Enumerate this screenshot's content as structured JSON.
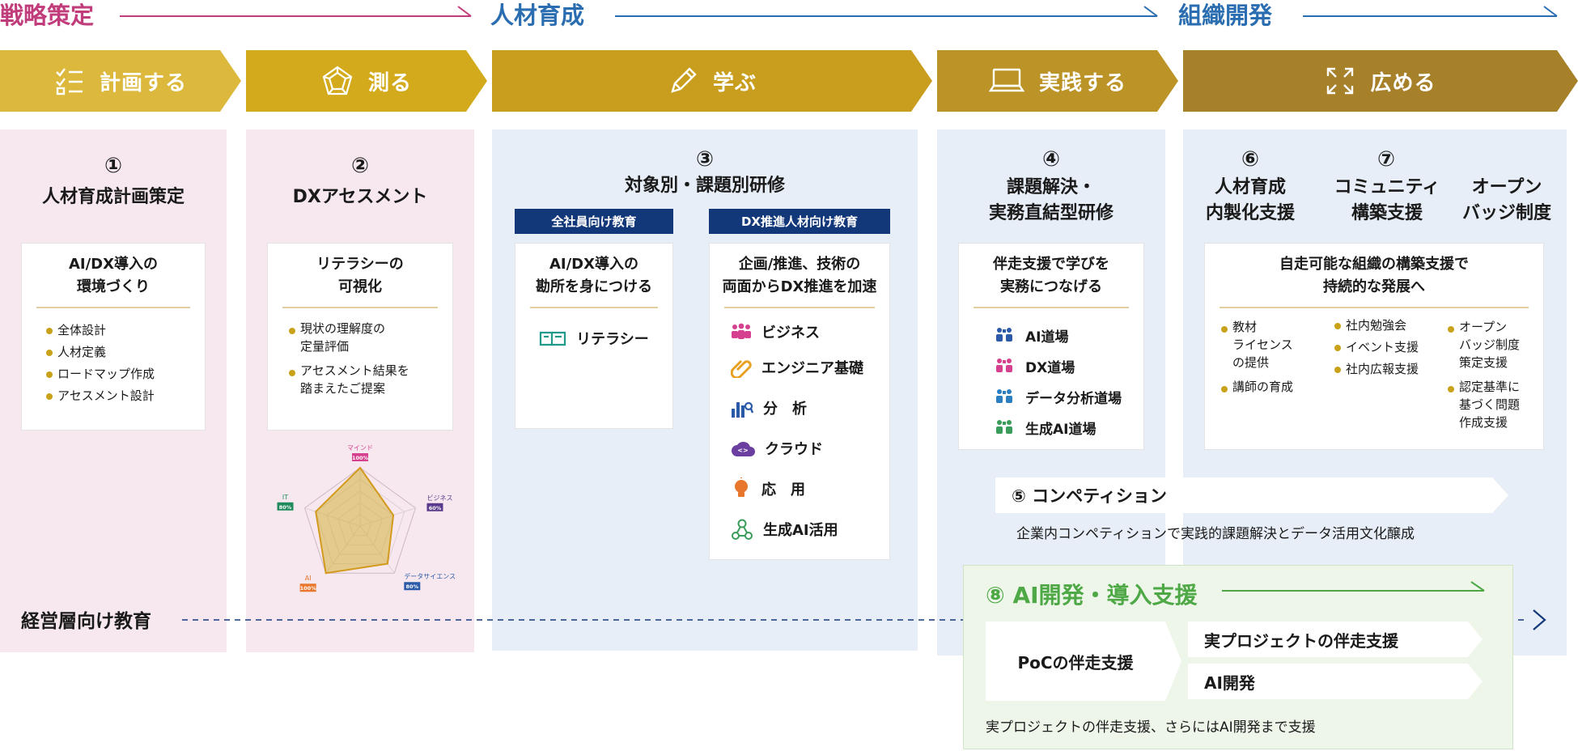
{
  "phases": [
    {
      "label": "戦略策定",
      "color": "#c13c7a"
    },
    {
      "label": "人材育成",
      "color": "#2a6db0"
    },
    {
      "label": "組織開発",
      "color": "#2a6db0"
    }
  ],
  "steps": [
    {
      "label": "計画する",
      "icon": "checklist-icon"
    },
    {
      "label": "測る",
      "icon": "pentagon-icon"
    },
    {
      "label": "学ぶ",
      "icon": "pencil-icon"
    },
    {
      "label": "実践する",
      "icon": "laptop-icon"
    },
    {
      "label": "広める",
      "icon": "expand-icon"
    }
  ],
  "col1": {
    "num": "①",
    "title": "人材育成計画策定",
    "card_head": [
      "AI/DX導入の",
      "環境づくり"
    ],
    "bullets": [
      "全体設計",
      "人材定義",
      "ロードマップ作成",
      "アセスメント設計"
    ]
  },
  "col2": {
    "num": "②",
    "title": "DXアセスメント",
    "card_head": [
      "リテラシーの",
      "可視化"
    ],
    "bullets": [
      [
        "現状の理解度の",
        "定量評価"
      ],
      [
        "アセスメント結果を",
        "踏まえたご提案"
      ]
    ],
    "radar": {
      "axes": [
        {
          "label": "マインド",
          "value": "100%",
          "color": "#d6418f"
        },
        {
          "label": "ビジネス",
          "value": "60%",
          "color": "#5a3a8c"
        },
        {
          "label": "データサイエンス",
          "value": "80%",
          "color": "#2b5aa8"
        },
        {
          "label": "AI",
          "value": "100%",
          "color": "#e8762d"
        },
        {
          "label": "IT",
          "value": "80%",
          "color": "#1f8a5c"
        }
      ],
      "values": [
        1.0,
        0.6,
        0.8,
        1.0,
        0.8
      ]
    }
  },
  "col3": {
    "num": "③",
    "title": "対象別・課題別研修",
    "left_bar": "全社員向け教育",
    "right_bar": "DX推進人材向け教育",
    "left_head": [
      "AI/DX導入の",
      "勘所を身につける"
    ],
    "left_item": "リテラシー",
    "right_head": [
      "企画/推進、技術の",
      "両面からDX推進を加速"
    ],
    "right_items": [
      {
        "label": "ビジネス",
        "icon": "people-icon",
        "color": "#d6418f"
      },
      {
        "label": "エンジニア基礎",
        "icon": "clip-icon",
        "color": "#e8a020"
      },
      {
        "label": "分　析",
        "icon": "bar-chart-icon",
        "color": "#2b5aa8"
      },
      {
        "label": "クラウド",
        "icon": "cloud-icon",
        "color": "#6a3fa0"
      },
      {
        "label": "応　用",
        "icon": "bulb-icon",
        "color": "#e8762d"
      },
      {
        "label": "生成AI活用",
        "icon": "network-icon",
        "color": "#3a9c5a"
      }
    ]
  },
  "col4": {
    "num": "④",
    "title": [
      "課題解決・",
      "実務直結型研修"
    ],
    "card_head": [
      "伴走支援で学びを",
      "実務につなげる"
    ],
    "items": [
      {
        "label": "AI道場",
        "color": "#2b5aa8"
      },
      {
        "label": "DX道場",
        "color": "#d6418f"
      },
      {
        "label": "データ分析道場",
        "color": "#2b7fc0"
      },
      {
        "label": "生成AI道場",
        "color": "#3a9c5a"
      }
    ]
  },
  "col5": {
    "nums": [
      "⑥",
      "⑦"
    ],
    "titles": [
      [
        "人材育成",
        "内製化支援"
      ],
      [
        "コミュニティ",
        "構築支援"
      ],
      [
        "オープン",
        "バッジ制度"
      ]
    ],
    "card_head": [
      "自走可能な組織の構築支援で",
      "持続的な発展へ"
    ],
    "bullets_a": [
      [
        "教材",
        "ライセンス",
        "の提供"
      ],
      [
        "講師の育成"
      ]
    ],
    "bullets_b": [
      [
        "社内勉強会"
      ],
      [
        "イベント支援"
      ],
      [
        "社内広報支援"
      ]
    ],
    "bullets_c": [
      [
        "オープン",
        "バッジ制度",
        "策定支援"
      ],
      [
        "認定基準に",
        "基づく問題",
        "作成支援"
      ]
    ]
  },
  "competition": {
    "label": "⑤ コンペティション",
    "desc": "企業内コンペティションで実践的課題解決とデータ活用文化醸成"
  },
  "executive": "経営層向け教育",
  "ai_dev": {
    "title": "⑧ AI開発・導入支援",
    "poc": "PoCの伴走支援",
    "real": "実プロジェクトの伴走支援",
    "dev": "AI開発",
    "desc": "実プロジェクトの伴走支援、さらにはAI開発まで支援"
  },
  "colors": {
    "pink_bg": "#f7e8ef",
    "blue_bg": "#e7eef7",
    "green_bg": "#eef6ea",
    "green": "#4ea846",
    "gold": "#c9a21a",
    "navy": "#13387a"
  }
}
